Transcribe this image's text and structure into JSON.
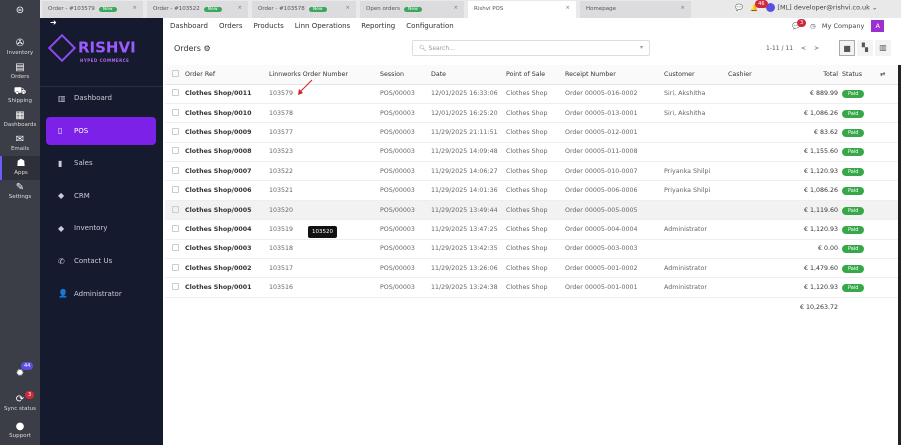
{
  "tabs": [
    {
      "label": "Order - #103579",
      "badge": "New"
    },
    {
      "label": "Order - #103522",
      "badge": "New"
    },
    {
      "label": "Order - #103578",
      "badge": "New"
    },
    {
      "label": "Open orders",
      "badge": "New"
    },
    {
      "label": "Rishvi POS",
      "badge": ""
    },
    {
      "label": "Homepage",
      "badge": ""
    }
  ],
  "topbar": {
    "notif_count": "46",
    "user": "[ML] developer@rishvi.co.uk",
    "company": "My Company",
    "avatar": "A",
    "msg_count": "3"
  },
  "rail": [
    {
      "label": "Inventory",
      "icon": "inventory-icon"
    },
    {
      "label": "Orders",
      "icon": "orders-icon"
    },
    {
      "label": "Shipping",
      "icon": "truck-icon"
    },
    {
      "label": "Dashboards",
      "icon": "chart-icon"
    },
    {
      "label": "Emails",
      "icon": "mail-icon"
    },
    {
      "label": "Apps",
      "icon": "apps-icon"
    },
    {
      "label": "Settings",
      "icon": "wrench-icon"
    }
  ],
  "rail_bottom": {
    "tips_count": "44",
    "sync_label": "Sync status",
    "sync_count": "3",
    "support_label": "Support"
  },
  "logo": {
    "name": "RISHVI",
    "tagline": "HYPED COMMERCE"
  },
  "sidebar": [
    {
      "label": "Dashboard"
    },
    {
      "label": "POS"
    },
    {
      "label": "Sales"
    },
    {
      "label": "CRM"
    },
    {
      "label": "Inventory"
    },
    {
      "label": "Contact Us"
    },
    {
      "label": "Administrator"
    }
  ],
  "nav": [
    "Dashboard",
    "Orders",
    "Products",
    "Linn Operations",
    "Reporting",
    "Configuration"
  ],
  "page": {
    "title": "Orders",
    "search_placeholder": "Search...",
    "pager": "1-11 / 11"
  },
  "columns": [
    "Order Ref",
    "Linnworks Order Number",
    "Session",
    "Date",
    "Point of Sale",
    "Receipt Number",
    "Customer",
    "Cashier",
    "Total",
    "Status"
  ],
  "rows": [
    [
      "Clothes Shop/0011",
      "103579",
      "POS/00003",
      "12/01/2025 16:33:06",
      "Clothes Shop",
      "Order 00005-016-0002",
      "Siri, Akshitha",
      "",
      "€ 889.99",
      "Paid"
    ],
    [
      "Clothes Shop/0010",
      "103578",
      "POS/00003",
      "12/01/2025 16:25:20",
      "Clothes Shop",
      "Order 00005-013-0001",
      "Siri, Akshitha",
      "",
      "€ 1,086.26",
      "Paid"
    ],
    [
      "Clothes Shop/0009",
      "103577",
      "POS/00003",
      "11/29/2025 21:11:51",
      "Clothes Shop",
      "Order 00005-012-0001",
      "",
      "",
      "€ 83.62",
      "Paid"
    ],
    [
      "Clothes Shop/0008",
      "103523",
      "POS/00003",
      "11/29/2025 14:09:48",
      "Clothes Shop",
      "Order 00005-011-0008",
      "",
      "",
      "€ 1,155.60",
      "Paid"
    ],
    [
      "Clothes Shop/0007",
      "103522",
      "POS/00003",
      "11/29/2025 14:06:27",
      "Clothes Shop",
      "Order 00005-010-0007",
      "Priyanka Shilpi",
      "",
      "€ 1,120.93",
      "Paid"
    ],
    [
      "Clothes Shop/0006",
      "103521",
      "POS/00003",
      "11/29/2025 14:01:36",
      "Clothes Shop",
      "Order 00005-006-0006",
      "Priyanka Shilpi",
      "",
      "€ 1,086.26",
      "Paid"
    ],
    [
      "Clothes Shop/0005",
      "103520",
      "POS/00003",
      "11/29/2025 13:49:44",
      "Clothes Shop",
      "Order 00005-005-0005",
      "",
      "",
      "€ 1,119.60",
      "Paid"
    ],
    [
      "Clothes Shop/0004",
      "103519",
      "POS/00003",
      "11/29/2025 13:47:25",
      "Clothes Shop",
      "Order 00005-004-0004",
      "Administrator",
      "",
      "€ 1,120.93",
      "Paid"
    ],
    [
      "Clothes Shop/0003",
      "103518",
      "POS/00003",
      "11/29/2025 13:42:35",
      "Clothes Shop",
      "Order 00005-003-0003",
      "",
      "",
      "€ 0.00",
      "Paid"
    ],
    [
      "Clothes Shop/0002",
      "103517",
      "POS/00003",
      "11/29/2025 13:26:06",
      "Clothes Shop",
      "Order 00005-001-0002",
      "Administrator",
      "",
      "€ 1,479.60",
      "Paid"
    ],
    [
      "Clothes Shop/0001",
      "103516",
      "POS/00003",
      "11/29/2025 13:24:38",
      "Clothes Shop",
      "Order 00005-001-0001",
      "Administrator",
      "",
      "€ 1,120.93",
      "Paid"
    ]
  ],
  "grand_total": "€ 10,263.72",
  "tooltip": "103520",
  "colors": {
    "accent": "#7c22e8",
    "paid": "#37a84a",
    "sidebar": "#161a2e"
  }
}
